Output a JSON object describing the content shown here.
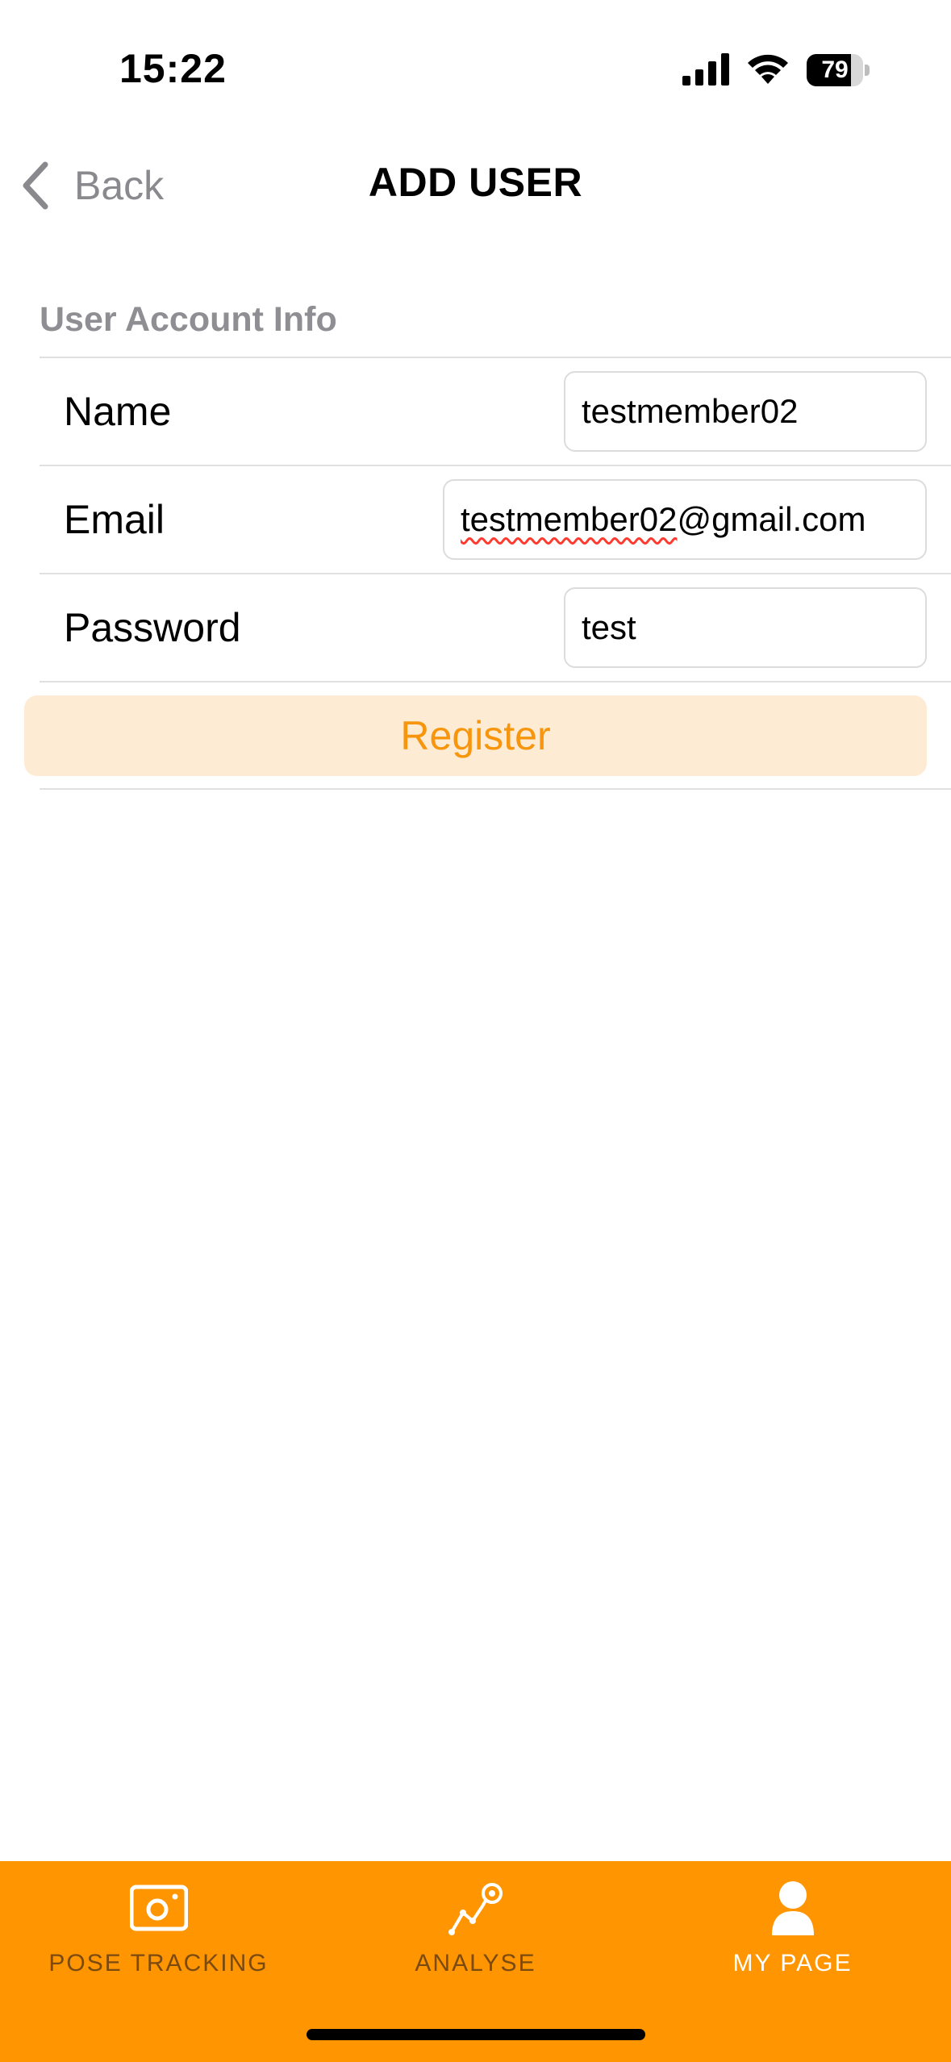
{
  "status_bar": {
    "time": "15:22",
    "battery_level": "79",
    "battery_fraction": 0.79
  },
  "nav": {
    "back_label": "Back",
    "title": "ADD USER"
  },
  "form": {
    "section_header": "User Account Info",
    "fields": [
      {
        "label": "Name",
        "value": "testmember02"
      },
      {
        "label": "Email",
        "value_underlined": "testmember02",
        "value_rest": "@gmail.com"
      },
      {
        "label": "Password",
        "value": "test"
      }
    ],
    "register_label": "Register"
  },
  "tab_bar": {
    "tabs": [
      {
        "label": "POSE TRACKING",
        "icon": "camera-icon",
        "active": false
      },
      {
        "label": "ANALYSE",
        "icon": "analytics-icon",
        "active": false
      },
      {
        "label": "MY PAGE",
        "icon": "person-icon",
        "active": true
      }
    ]
  },
  "colors": {
    "accent": "#ff9500",
    "register_bg": "#fdebd4",
    "register_text": "#f7960c",
    "tab_inactive": "#7a4a10",
    "tab_active": "#ffffff"
  }
}
